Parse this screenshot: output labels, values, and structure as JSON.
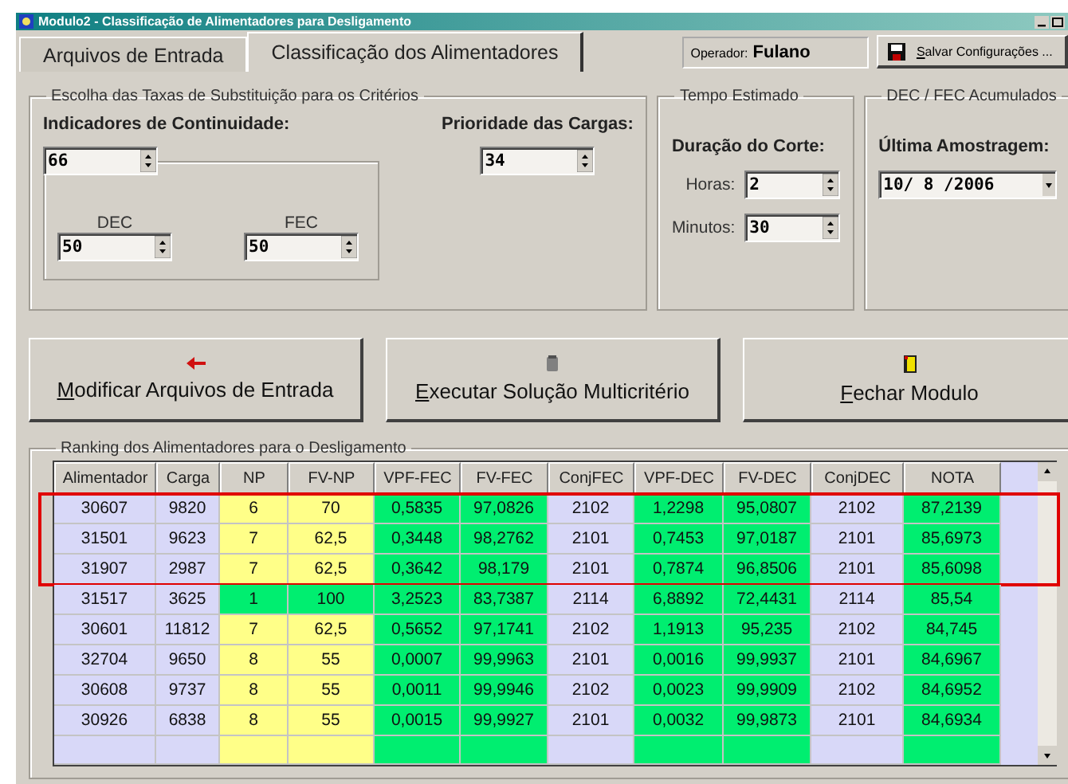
{
  "window": {
    "title": "Modulo2 - Classificação de Alimentadores para Desligamento"
  },
  "tabs": [
    {
      "label": "Arquivos de Entrada",
      "selected": false
    },
    {
      "label": "Classificação dos Alimentadores",
      "selected": true
    }
  ],
  "operator": {
    "label": "Operador:",
    "value": "Fulano"
  },
  "save_button": "Salvar Configurações ...",
  "criteria": {
    "title": "Escolha das Taxas de Substituição para os Critérios",
    "continuity_label": "Indicadores de Continuidade:",
    "continuity_value": "66",
    "dec_label": "DEC",
    "dec_value": "50",
    "fec_label": "FEC",
    "fec_value": "50",
    "priority_label": "Prioridade das Cargas:",
    "priority_value": "34"
  },
  "time": {
    "title": "Tempo Estimado",
    "duration_label": "Duração do Corte:",
    "hours_label": "Horas:",
    "hours_value": "2",
    "minutes_label": "Minutos:",
    "minutes_value": "30"
  },
  "accumulated": {
    "title": "DEC / FEC Acumulados",
    "sample_label": "Última Amostragem:",
    "sample_value": "10/ 8 /2006"
  },
  "actions": [
    {
      "label": "Modificar Arquivos de Entrada",
      "kind": "modify"
    },
    {
      "label": "Executar Solução Multicritério",
      "kind": "execute"
    },
    {
      "label": "Fechar Modulo",
      "kind": "close"
    }
  ],
  "ranking": {
    "title": "Ranking dos Alimentadores para o Desligamento",
    "columns": [
      "Alimentador",
      "Carga",
      "NP",
      "FV-NP",
      "VPF-FEC",
      "FV-FEC",
      "ConjFEC",
      "VPF-DEC",
      "FV-DEC",
      "ConjDEC",
      "NOTA"
    ],
    "framed_rows": [
      {
        "cells": [
          "30607",
          "9820",
          "6",
          "70",
          "0,5835",
          "97,0826",
          "2102",
          "1,2298",
          "95,0807",
          "2102",
          "87,2139"
        ],
        "np_best": false
      },
      {
        "cells": [
          "31501",
          "9623",
          "7",
          "62,5",
          "0,3448",
          "98,2762",
          "2101",
          "0,7453",
          "97,0187",
          "2101",
          "85,6973"
        ],
        "np_best": false
      },
      {
        "cells": [
          "31907",
          "2987",
          "7",
          "62,5",
          "0,3642",
          "98,179",
          "2101",
          "0,7874",
          "96,8506",
          "2101",
          "85,6098"
        ],
        "np_best": false
      }
    ],
    "rows": [
      {
        "cells": [
          "31517",
          "3625",
          "1",
          "100",
          "3,2523",
          "83,7387",
          "2114",
          "6,8892",
          "72,4431",
          "2114",
          "85,54"
        ],
        "np_best": true
      },
      {
        "cells": [
          "30601",
          "11812",
          "7",
          "62,5",
          "0,5652",
          "97,1741",
          "2102",
          "1,1913",
          "95,235",
          "2102",
          "84,745"
        ],
        "np_best": false
      },
      {
        "cells": [
          "32704",
          "9650",
          "8",
          "55",
          "0,0007",
          "99,9963",
          "2101",
          "0,0016",
          "99,9937",
          "2101",
          "84,6967"
        ],
        "np_best": false
      },
      {
        "cells": [
          "30608",
          "9737",
          "8",
          "55",
          "0,0011",
          "99,9946",
          "2102",
          "0,0023",
          "99,9909",
          "2102",
          "84,6952"
        ],
        "np_best": false
      },
      {
        "cells": [
          "30926",
          "6838",
          "8",
          "55",
          "0,0015",
          "99,9927",
          "2101",
          "0,0032",
          "99,9873",
          "2101",
          "84,6934"
        ],
        "np_best": false
      }
    ]
  }
}
